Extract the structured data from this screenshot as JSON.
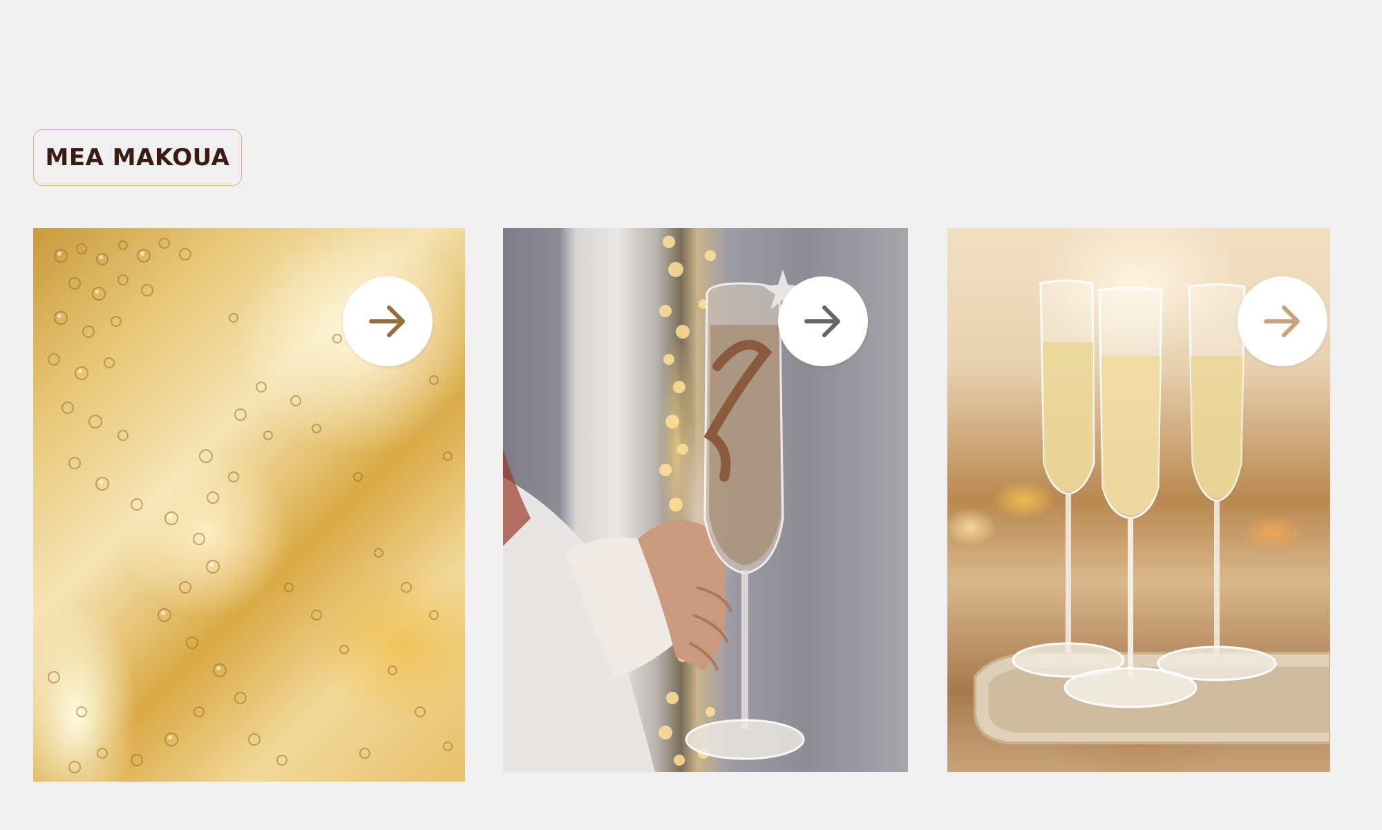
{
  "header": {
    "tag_label": "MEA MAKOUA"
  },
  "cards": [
    {
      "image": "champagne-bubbles",
      "button_icon": "arrow-right-icon",
      "icon_color": "#9a6b3c"
    },
    {
      "image": "hand-holding-champagne-flute",
      "button_icon": "arrow-right-icon",
      "icon_color": "#6b6466"
    },
    {
      "image": "three-champagne-flutes-on-tray",
      "button_icon": "arrow-right-icon",
      "icon_color": "#c9a27a"
    }
  ],
  "colors": {
    "background": "#f0f0f0",
    "tag_border": "#d8b27a",
    "tag_text": "#3a1a12",
    "button_bg": "#ffffff"
  }
}
